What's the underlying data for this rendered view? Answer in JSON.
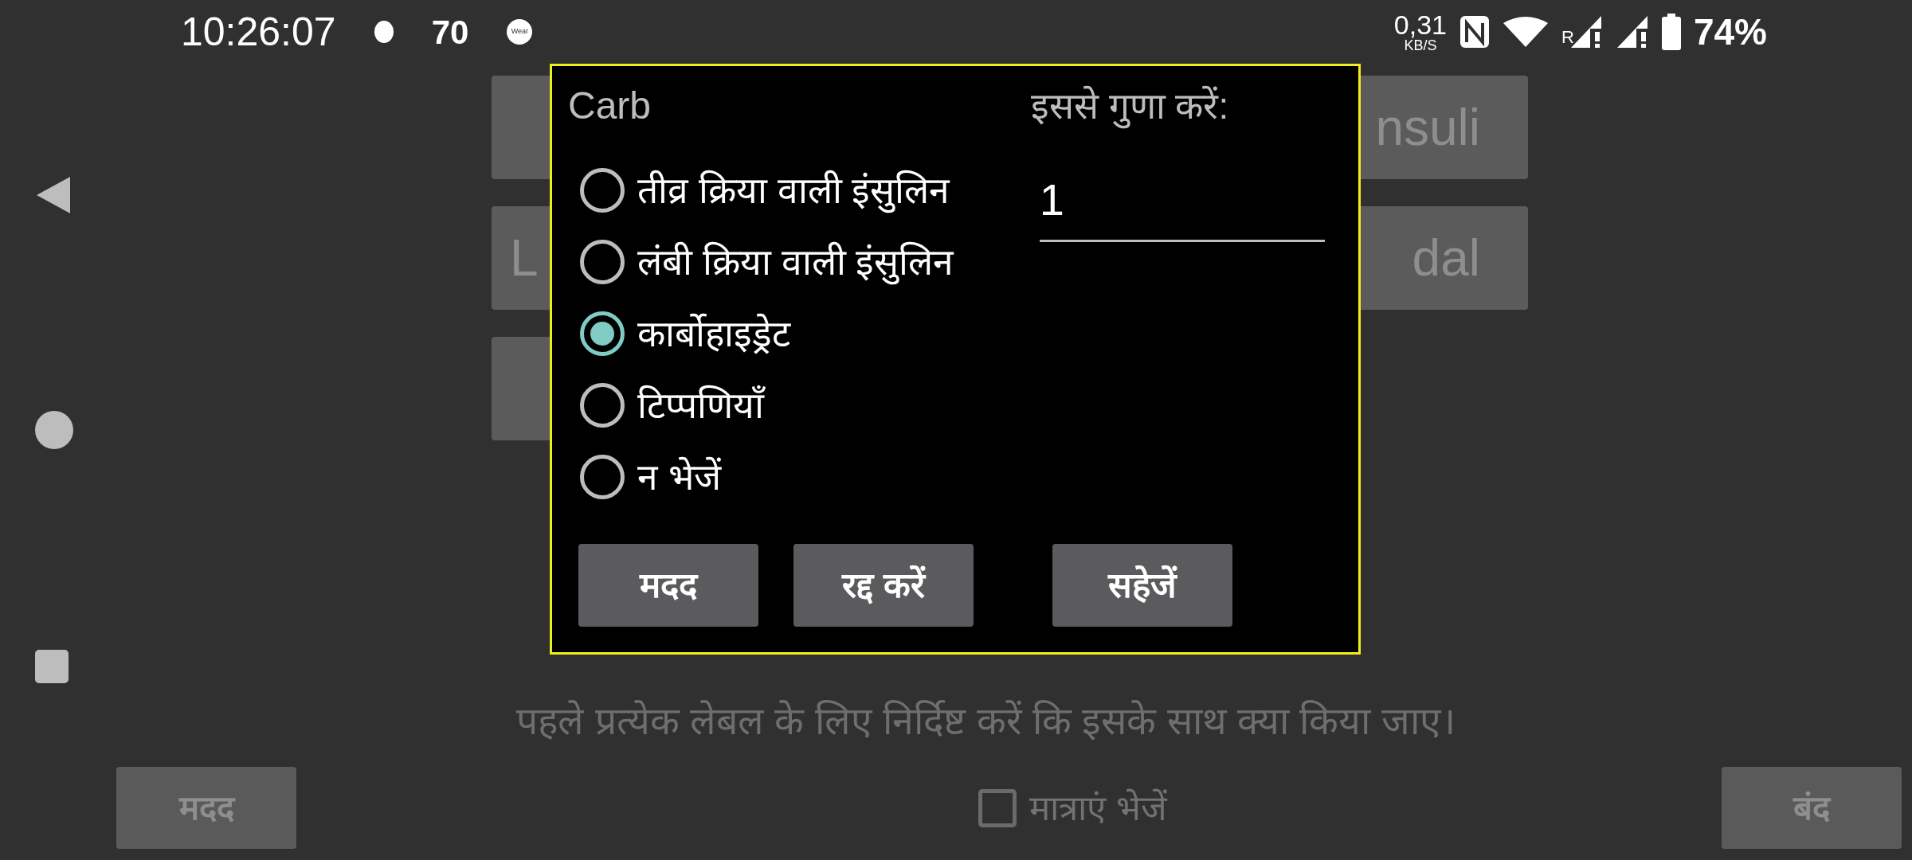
{
  "status_bar": {
    "time": "10:26:07",
    "notification_icons": [
      {
        "kind": "dot"
      },
      {
        "kind": "text",
        "text": "70"
      },
      {
        "kind": "badge",
        "text": "Wear"
      }
    ],
    "net_speed": {
      "value": "0,31",
      "unit": "KB/S"
    },
    "roaming_label": "R",
    "battery_percent": "74%"
  },
  "background_rows": [
    {
      "right_label": "nsuli"
    },
    {
      "left_label": "L",
      "right_label": "dal"
    }
  ],
  "dialog": {
    "title": "Carb",
    "multiplier_label": "इससे गुणा करें:",
    "multiplier_value": "1",
    "options": [
      {
        "label": "तीव्र क्रिया वाली इंसुलिन",
        "selected": false
      },
      {
        "label": "लंबी क्रिया वाली इंसुलिन",
        "selected": false
      },
      {
        "label": "कार्बोहाइड्रेट",
        "selected": true
      },
      {
        "label": "टिप्पणियाँ",
        "selected": false
      },
      {
        "label": "न भेजें",
        "selected": false
      }
    ],
    "buttons": [
      "मदद",
      "रद्द करें",
      "सहेजें"
    ]
  },
  "hint": "पहले प्रत्येक लेबल के लिए निर्दिष्ट करें कि इसके साथ क्या किया जाए।",
  "bottom_bar": {
    "help_button": "मदद",
    "send_amounts": {
      "label": "मात्राएं भेजें",
      "checked": false
    },
    "close_button": "बंद"
  }
}
